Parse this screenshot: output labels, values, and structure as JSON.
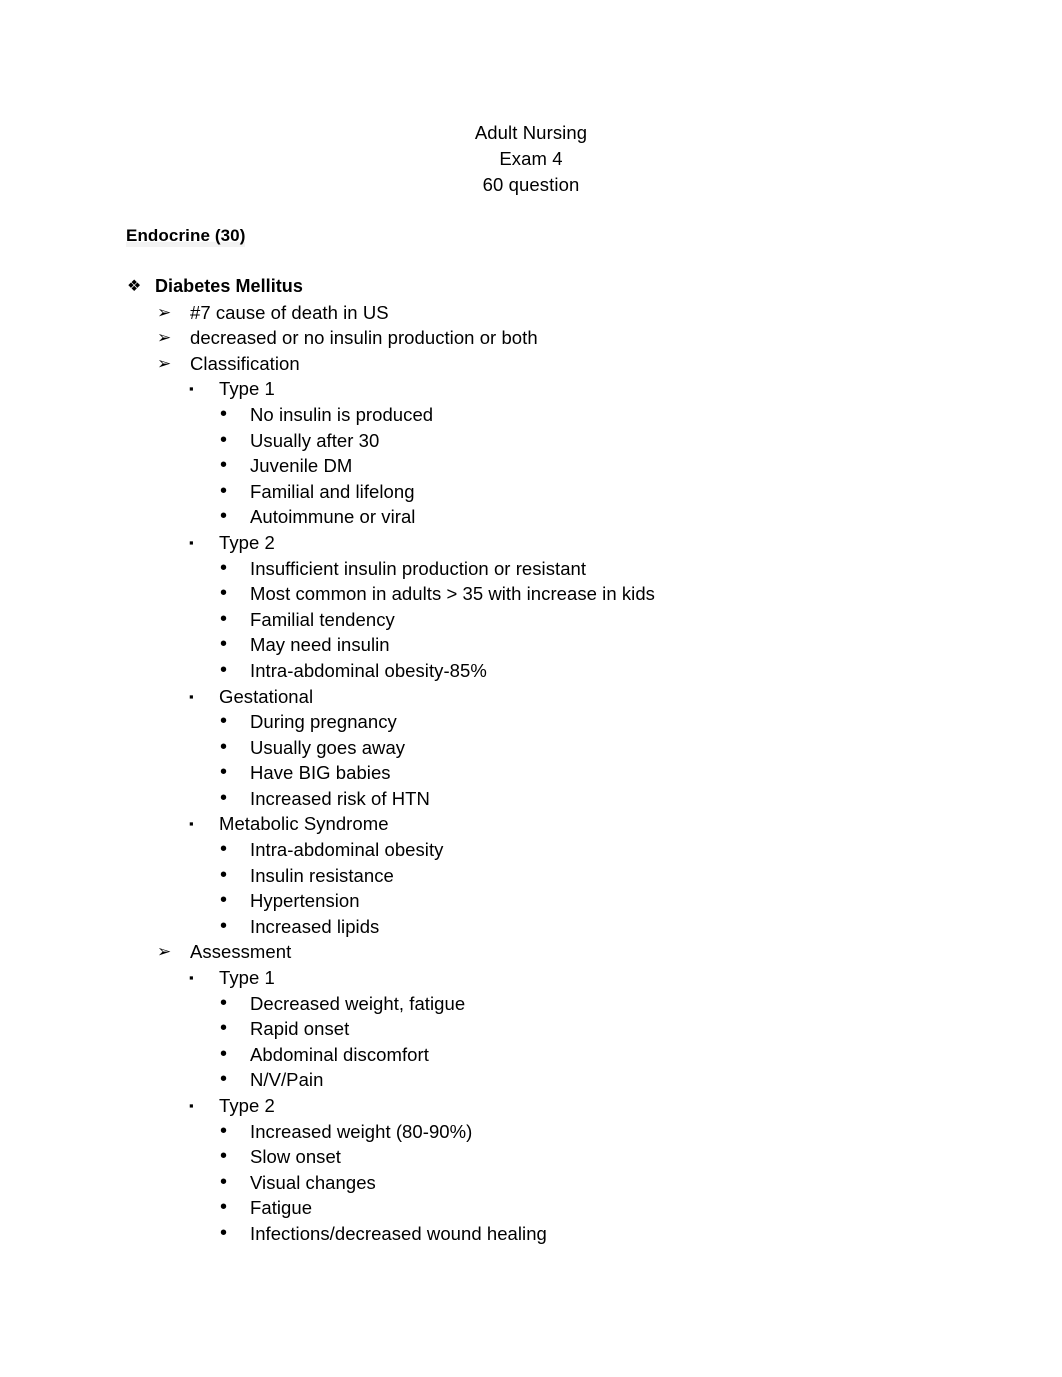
{
  "document": {
    "header_lines": [
      "Adult Nursing",
      "Exam 4",
      "60 question"
    ],
    "section_heading": "Endocrine (30)"
  },
  "markers": {
    "level1": "❖",
    "level2": "➢",
    "level3": "▪",
    "level4": "•"
  },
  "outline": [
    {
      "level": 1,
      "text": "Diabetes Mellitus"
    },
    {
      "level": 2,
      "text": "#7 cause of death in US"
    },
    {
      "level": 2,
      "text": "decreased or no insulin production or both"
    },
    {
      "level": 2,
      "text": "Classification"
    },
    {
      "level": 3,
      "text": "Type 1"
    },
    {
      "level": 4,
      "text": "No insulin is produced"
    },
    {
      "level": 4,
      "text": "Usually after 30"
    },
    {
      "level": 4,
      "text": "Juvenile DM"
    },
    {
      "level": 4,
      "text": "Familial and lifelong"
    },
    {
      "level": 4,
      "text": "Autoimmune or viral"
    },
    {
      "level": 3,
      "text": "Type 2"
    },
    {
      "level": 4,
      "text": "Insufficient insulin production or resistant"
    },
    {
      "level": 4,
      "text": "Most common in adults > 35 with increase in kids"
    },
    {
      "level": 4,
      "text": "Familial tendency"
    },
    {
      "level": 4,
      "text": "May need insulin"
    },
    {
      "level": 4,
      "text": "Intra-abdominal obesity-85%"
    },
    {
      "level": 3,
      "text": "Gestational"
    },
    {
      "level": 4,
      "text": "During pregnancy"
    },
    {
      "level": 4,
      "text": "Usually goes away"
    },
    {
      "level": 4,
      "text": "Have BIG babies"
    },
    {
      "level": 4,
      "text": "Increased risk of HTN"
    },
    {
      "level": 3,
      "text": "Metabolic Syndrome"
    },
    {
      "level": 4,
      "text": "Intra-abdominal obesity"
    },
    {
      "level": 4,
      "text": "Insulin resistance"
    },
    {
      "level": 4,
      "text": "Hypertension"
    },
    {
      "level": 4,
      "text": "Increased lipids"
    },
    {
      "level": 2,
      "text": "Assessment"
    },
    {
      "level": 3,
      "text": "Type 1"
    },
    {
      "level": 4,
      "text": "Decreased weight, fatigue"
    },
    {
      "level": 4,
      "text": "Rapid onset"
    },
    {
      "level": 4,
      "text": "Abdominal discomfort"
    },
    {
      "level": 4,
      "text": "N/V/Pain"
    },
    {
      "level": 3,
      "text": "Type 2"
    },
    {
      "level": 4,
      "text": "Increased weight (80-90%)"
    },
    {
      "level": 4,
      "text": "Slow onset"
    },
    {
      "level": 4,
      "text": "Visual changes"
    },
    {
      "level": 4,
      "text": "Fatigue"
    },
    {
      "level": 4,
      "text": "Infections/decreased wound healing"
    }
  ]
}
